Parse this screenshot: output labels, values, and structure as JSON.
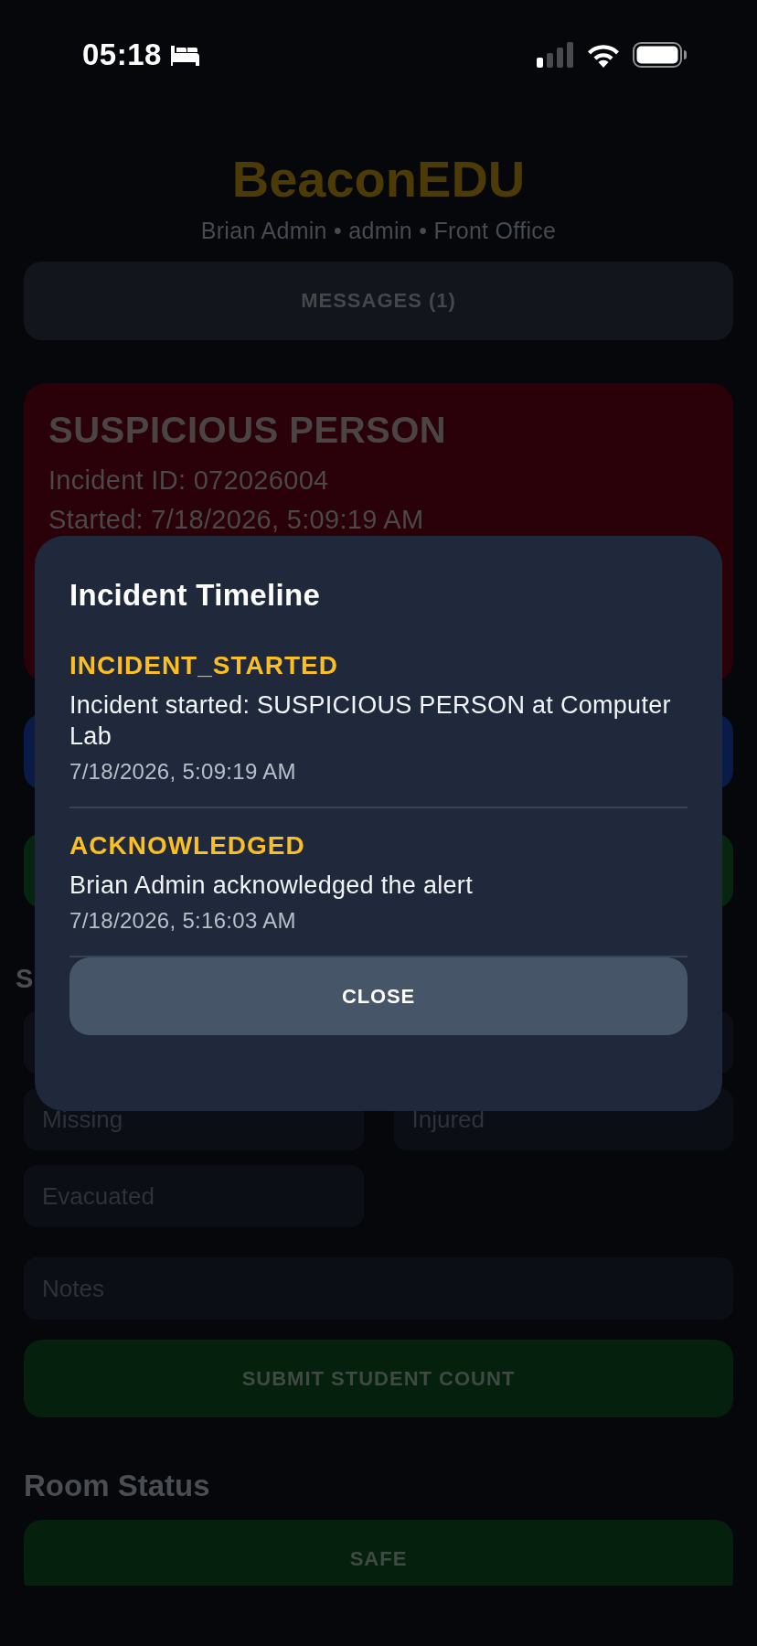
{
  "status_bar": {
    "time": "05:18"
  },
  "header": {
    "title": "BeaconEDU",
    "subtitle": "Brian Admin • admin • Front Office"
  },
  "messages_button": {
    "label": "MESSAGES (1)"
  },
  "incident_card": {
    "title": "SUSPICIOUS PERSON",
    "lines": [
      "Incident ID: 072026004",
      "Started: 7/18/2026, 5:09:19 AM"
    ]
  },
  "covered_buttons": [
    {
      "color": "#0a1b47"
    },
    {
      "color": "#07260f"
    }
  ],
  "student_count": {
    "heading": "S",
    "fields": [
      {
        "kind": "covered"
      },
      {
        "kind": "covered"
      },
      {
        "kind": "text",
        "placeholder": "Missing"
      },
      {
        "kind": "text",
        "placeholder": "Injured"
      },
      {
        "kind": "text",
        "placeholder": "Evacuated"
      }
    ],
    "notes": {
      "placeholder": "Notes"
    },
    "submit_button": {
      "label": "SUBMIT STUDENT COUNT"
    }
  },
  "room_status": {
    "heading": "Room Status",
    "buttons": [
      {
        "label": "SAFE"
      }
    ]
  },
  "timeline_modal": {
    "title": "Incident Timeline",
    "events": [
      {
        "type": "INCIDENT_STARTED",
        "description": "Incident started: SUSPICIOUS PERSON at Computer Lab",
        "time": "7/18/2026, 5:09:19 AM"
      },
      {
        "type": "ACKNOWLEDGED",
        "description": "Brian Admin acknowledged the alert",
        "time": "7/18/2026, 5:16:03 AM"
      }
    ],
    "close_button": {
      "label": "CLOSE"
    }
  }
}
